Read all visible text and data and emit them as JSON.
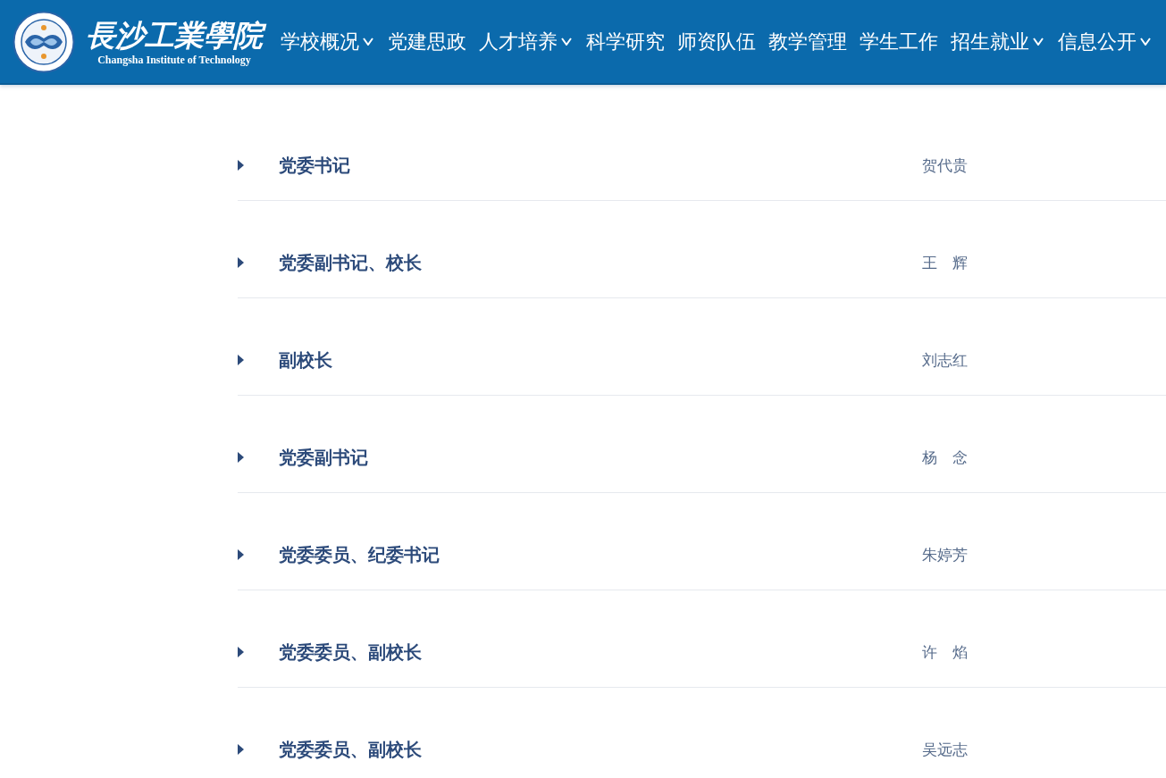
{
  "header": {
    "logo": {
      "name_cn": "長沙工業學院",
      "name_en": "Changsha Institute of Technology"
    },
    "nav": [
      {
        "label": "学校概况",
        "has_dropdown": true
      },
      {
        "label": "党建思政",
        "has_dropdown": false
      },
      {
        "label": "人才培养",
        "has_dropdown": true
      },
      {
        "label": "科学研究",
        "has_dropdown": false
      },
      {
        "label": "师资队伍",
        "has_dropdown": false
      },
      {
        "label": "教学管理",
        "has_dropdown": false
      },
      {
        "label": "学生工作",
        "has_dropdown": false
      },
      {
        "label": "招生就业",
        "has_dropdown": true
      },
      {
        "label": "信息公开",
        "has_dropdown": true
      }
    ]
  },
  "leaders": [
    {
      "title": "党委书记",
      "name": "贺代贵"
    },
    {
      "title": "党委副书记、校长",
      "name": "王　辉"
    },
    {
      "title": "副校长",
      "name": "刘志红"
    },
    {
      "title": "党委副书记",
      "name": "杨　念"
    },
    {
      "title": "党委委员、纪委书记",
      "name": "朱婷芳"
    },
    {
      "title": "党委委员、副校长",
      "name": "许　焰"
    },
    {
      "title": "党委委员、副校长",
      "name": "吴远志"
    }
  ]
}
